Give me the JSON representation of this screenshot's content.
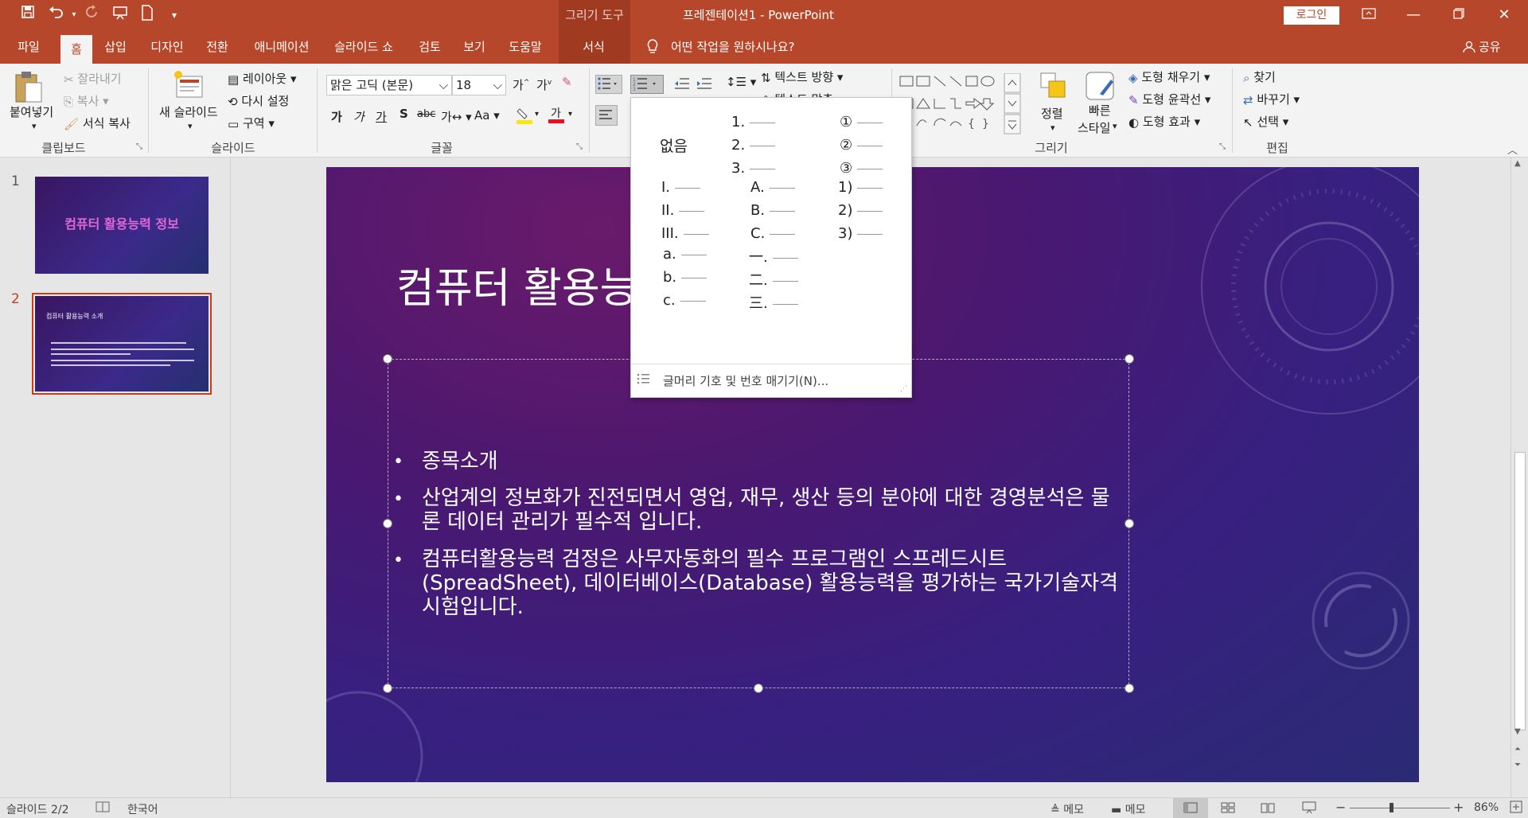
{
  "app": {
    "doc_title": "프레젠테이션1  -  PowerPoint",
    "context_tool": "그리기 도구",
    "login": "로그인"
  },
  "tabs": [
    "파일",
    "홈",
    "삽입",
    "디자인",
    "전환",
    "애니메이션",
    "슬라이드 쇼",
    "검토",
    "보기",
    "도움말",
    "서식"
  ],
  "tell_me": "어떤 작업을 원하시나요?",
  "share": "공유",
  "ribbon": {
    "clipboard": {
      "paste": "붙여넣기",
      "cut": "잘라내기",
      "copy": "복사",
      "format_painter": "서식 복사",
      "label": "클립보드"
    },
    "slides": {
      "new_slide": "새 슬라이드",
      "layout": "레이아웃",
      "reset": "다시 설정",
      "section": "구역",
      "label": "슬라이드"
    },
    "font": {
      "name": "맑은 고딕 (본문)",
      "size": "18",
      "label": "글꼴"
    },
    "paragraph": {
      "text_direction": "텍스트 방향",
      "align_text": "텍스트 맞춤"
    },
    "drawing": {
      "arrange": "정렬",
      "quick_styles_1": "빠른",
      "quick_styles_2": "스타일",
      "fill": "도형 채우기",
      "outline": "도형 윤곽선",
      "effects": "도형 효과",
      "label": "그리기"
    },
    "editing": {
      "find": "찾기",
      "replace": "바꾸기",
      "select": "선택",
      "label": "편집"
    }
  },
  "thumbnails": [
    {
      "num": "1",
      "title": "컴퓨터 활용능력 정보"
    },
    {
      "num": "2",
      "title": "컴퓨터 활용능력 소개"
    }
  ],
  "slide": {
    "title": "컴퓨터 활용능",
    "bullets": [
      "종목소개",
      "산업계의 정보화가 진전되면서 영업, 재무, 생산 등의 분야에 대한 경영분석은 물론 데이터 관리가 필수적 입니다.",
      "컴퓨터활용능력 검정은 사무자동화의 필수 프로그램인 스프레드시트(SpreadSheet), 데이터베이스(Database) 활용능력을 평가하는 국가기술자격 시험입니다."
    ]
  },
  "numbering": {
    "none": "없음",
    "col1": [
      "1.",
      "2.",
      "3."
    ],
    "col2": [
      "①",
      "②",
      "③"
    ],
    "row2_col0": [
      "I.",
      "II.",
      "III."
    ],
    "row2_col1": [
      "A.",
      "B.",
      "C."
    ],
    "row2_col2": [
      "1)",
      "2)",
      "3)"
    ],
    "row3_col0": [
      "a.",
      "b.",
      "c."
    ],
    "row3_col1": [
      "一.",
      "二.",
      "三."
    ],
    "footer": "글머리 기호 및 번호 매기기(N)..."
  },
  "status": {
    "slide_pos": "슬라이드 2/2",
    "language": "한국어",
    "notes": "메모",
    "comments": "메모",
    "zoom": "86%"
  },
  "colors": {
    "accent": "#b7472a",
    "font_color": "#e81123",
    "highlight": "#ffe600"
  }
}
